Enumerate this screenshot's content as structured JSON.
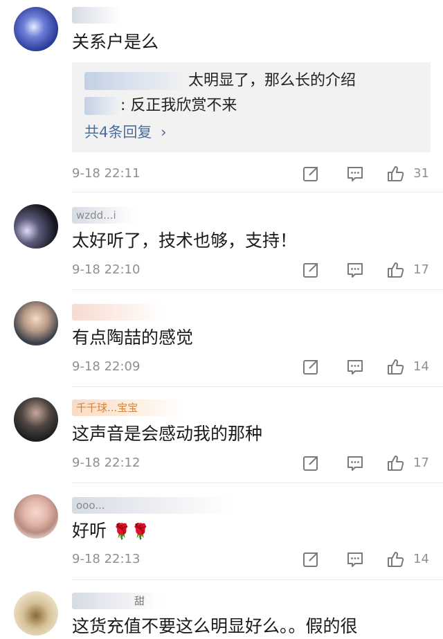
{
  "comments": [
    {
      "username": "",
      "text": "关系户是么",
      "replies": [
        {
          "name": "",
          "text": "太明显了，那么长的介绍"
        },
        {
          "name": "__59",
          "text": ": 反正我欣赏不来"
        }
      ],
      "replies_more": "共4条回复",
      "time": "9-18 22:11",
      "likes": "31"
    },
    {
      "username": "wzdd...i",
      "text": "太好听了，技术也够，支持！",
      "time": "9-18 22:10",
      "likes": "17"
    },
    {
      "username": "",
      "text": "有点陶喆的感觉",
      "time": "9-18 22:09",
      "likes": "14"
    },
    {
      "username": "千千球...宝宝",
      "text": "这声音是会感动我的那种",
      "time": "9-18 22:12",
      "likes": "17"
    },
    {
      "username": "ooo...",
      "text": "好听",
      "time": "9-18 22:13",
      "likes": "14"
    },
    {
      "username": "甜",
      "text": "这货充值不要这么明显好么。。假的很"
    }
  ],
  "icons": {
    "share": "share-icon",
    "comment": "comment-icon",
    "like": "thumbs-up-icon",
    "reply_chevron": "chevron-right-icon",
    "rose": "rose-emoji"
  },
  "colors": {
    "link": "#4a6e98",
    "meta": "#8f8f8f",
    "reply_bg": "#f2f2f2"
  }
}
